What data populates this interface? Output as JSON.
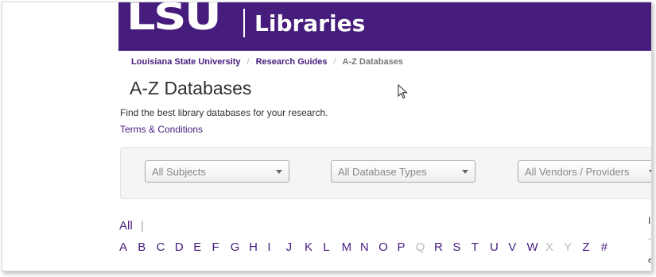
{
  "header": {
    "logo_text": "LSU",
    "site_name": "Libraries",
    "brand_color": "#461d7c"
  },
  "breadcrumb": [
    {
      "label": "Louisiana State University",
      "link": true
    },
    {
      "label": "Research Guides",
      "link": true
    },
    {
      "label": "A-Z Databases",
      "link": false
    }
  ],
  "breadcrumb_separator": "/",
  "page_title": "A-Z Databases",
  "description": "Find the best library databases for your research.",
  "terms_link": "Terms & Conditions",
  "filters": {
    "subjects": "All Subjects",
    "types": "All Database Types",
    "vendors": "All Vendors / Providers"
  },
  "az": {
    "all_label": "All",
    "pipe": "|",
    "letters": [
      {
        "l": "A",
        "on": true
      },
      {
        "l": "B",
        "on": true
      },
      {
        "l": "C",
        "on": true
      },
      {
        "l": "D",
        "on": true
      },
      {
        "l": "E",
        "on": true
      },
      {
        "l": "F",
        "on": true
      },
      {
        "l": "G",
        "on": true
      },
      {
        "l": "H",
        "on": true
      },
      {
        "l": "I",
        "on": true
      },
      {
        "l": "J",
        "on": true
      },
      {
        "l": "K",
        "on": true
      },
      {
        "l": "L",
        "on": true
      },
      {
        "l": "M",
        "on": true
      },
      {
        "l": "N",
        "on": true
      },
      {
        "l": "O",
        "on": true
      },
      {
        "l": "P",
        "on": true
      },
      {
        "l": "Q",
        "on": false
      },
      {
        "l": "R",
        "on": true
      },
      {
        "l": "S",
        "on": true
      },
      {
        "l": "T",
        "on": true
      },
      {
        "l": "U",
        "on": true
      },
      {
        "l": "V",
        "on": true
      },
      {
        "l": "W",
        "on": true
      },
      {
        "l": "X",
        "on": false
      },
      {
        "l": "Y",
        "on": false
      },
      {
        "l": "Z",
        "on": true
      },
      {
        "l": "#",
        "on": true
      }
    ]
  },
  "cursor_icon": "arrow-pointer-icon"
}
